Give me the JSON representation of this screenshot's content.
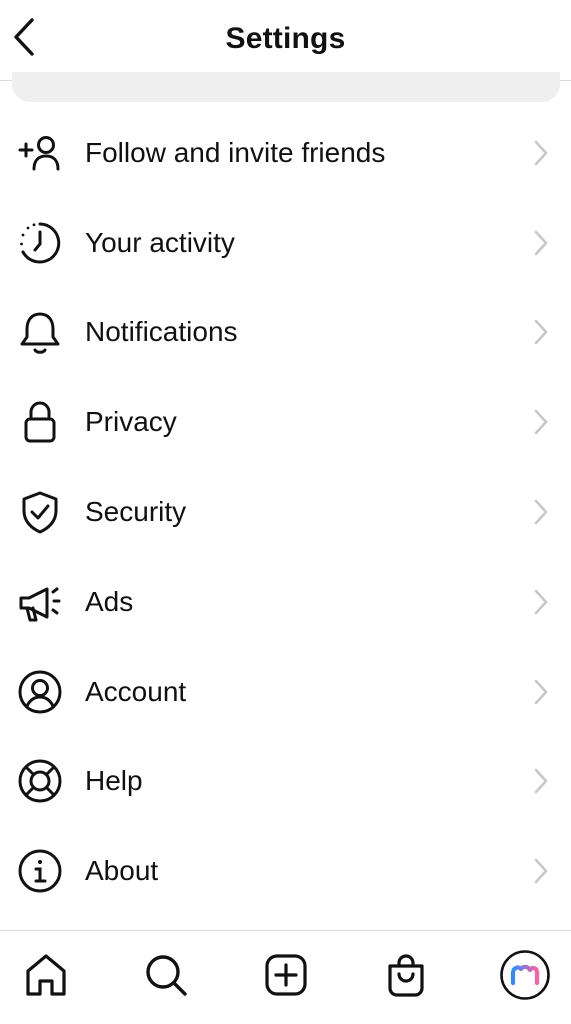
{
  "header": {
    "title": "Settings",
    "back_icon": "chevron-left-icon"
  },
  "menu": {
    "items": [
      {
        "label": "Follow and invite friends",
        "icon": "add-person-icon"
      },
      {
        "label": "Your activity",
        "icon": "activity-clock-icon"
      },
      {
        "label": "Notifications",
        "icon": "bell-icon"
      },
      {
        "label": "Privacy",
        "icon": "lock-icon"
      },
      {
        "label": "Security",
        "icon": "shield-check-icon"
      },
      {
        "label": "Ads",
        "icon": "megaphone-icon"
      },
      {
        "label": "Account",
        "icon": "account-circle-icon"
      },
      {
        "label": "Help",
        "icon": "lifebuoy-icon"
      },
      {
        "label": "About",
        "icon": "info-icon"
      }
    ]
  },
  "tabbar": {
    "tabs": [
      {
        "icon": "home-icon"
      },
      {
        "icon": "search-icon"
      },
      {
        "icon": "create-plus-icon"
      },
      {
        "icon": "shop-bag-icon"
      },
      {
        "icon": "profile-avatar-icon"
      }
    ]
  },
  "colors": {
    "text": "#111111",
    "divider": "#dbdbdb",
    "chevron": "#c7c7cc",
    "search_bg": "#efefef",
    "avatar_gradient_start": "#ff5fa2",
    "avatar_gradient_end": "#2f8cff"
  }
}
